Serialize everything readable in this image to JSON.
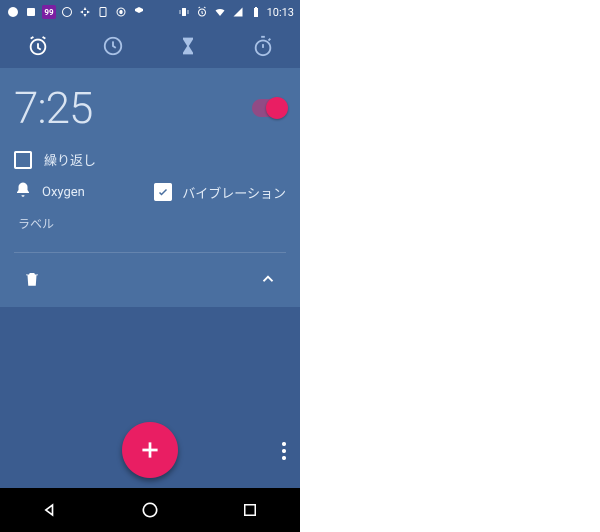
{
  "statusbar": {
    "time": "10:13"
  },
  "alarm": {
    "time": "7:25",
    "enabled": true,
    "repeat_label": "繰り返し",
    "repeat_checked": false,
    "ringtone": "Oxygen",
    "vibrate_label": "バイブレーション",
    "vibrate_checked": true,
    "label_placeholder": "ラベル"
  },
  "colors": {
    "accent": "#e91e63",
    "bg_dark": "#3b5c8f",
    "bg_card": "#4a6fa0"
  }
}
